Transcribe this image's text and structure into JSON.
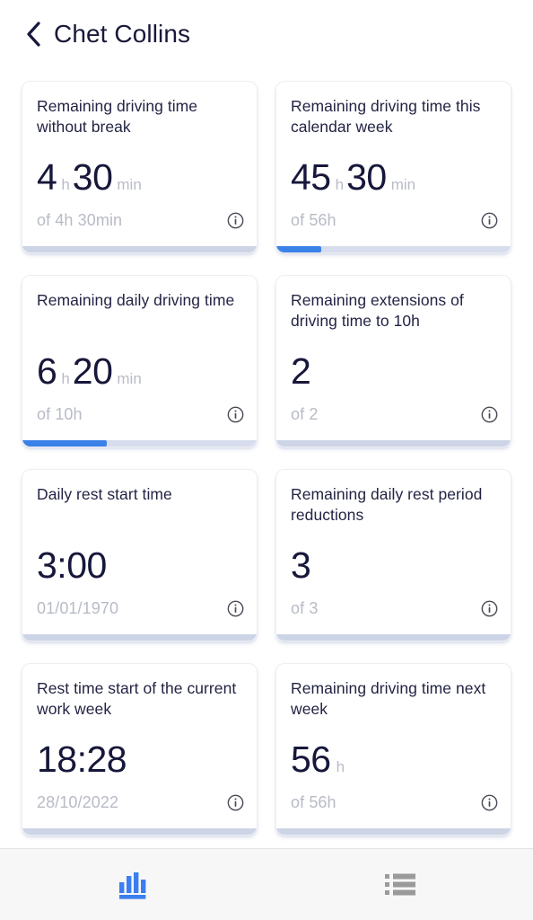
{
  "header": {
    "back_icon": "chevron-left-icon",
    "title": "Chet Collins"
  },
  "cards": [
    {
      "title": "Remaining driving time without break",
      "value": "4",
      "unit": "h",
      "value2": "30",
      "unit2": "min",
      "sub": "of 4h 30min",
      "info_icon": "info-icon",
      "progress_percent": 0
    },
    {
      "title": "Remaining driving time this calendar week",
      "value": "45",
      "unit": "h",
      "value2": "30",
      "unit2": "min",
      "sub": "of 56h",
      "info_icon": "info-icon",
      "progress_percent": 19
    },
    {
      "title": "Remaining daily driving time",
      "value": "6",
      "unit": "h",
      "value2": "20",
      "unit2": "min",
      "sub": "of 10h",
      "info_icon": "info-icon",
      "progress_percent": 36
    },
    {
      "title": "Remaining extensions of driving time to 10h",
      "value": "2",
      "unit": "",
      "value2": "",
      "unit2": "",
      "sub": "of 2",
      "info_icon": "info-icon",
      "progress_percent": 0
    },
    {
      "title": "Daily rest start time",
      "value": "3:00",
      "unit": "",
      "value2": "",
      "unit2": "",
      "sub": "01/01/1970",
      "info_icon": "info-icon",
      "progress_percent": 0
    },
    {
      "title": "Remaining daily rest period reductions",
      "value": "3",
      "unit": "",
      "value2": "",
      "unit2": "",
      "sub": "of 3",
      "info_icon": "info-icon",
      "progress_percent": 0
    },
    {
      "title": "Rest time start of the current work week",
      "value": "18:28",
      "unit": "",
      "value2": "",
      "unit2": "",
      "sub": "28/10/2022",
      "info_icon": "info-icon",
      "progress_percent": 0
    },
    {
      "title": "Remaining driving time next week",
      "value": "56",
      "unit": "h",
      "value2": "",
      "unit2": "",
      "sub": "of 56h",
      "info_icon": "info-icon",
      "progress_percent": 0
    }
  ],
  "bottom_nav": {
    "items": [
      {
        "icon": "bar-chart-icon",
        "active": true
      },
      {
        "icon": "list-icon",
        "active": false
      }
    ],
    "active_color": "#3b82e8",
    "inactive_color": "#9a9a9a"
  },
  "colors": {
    "accent_blue": "#3b82e8",
    "progress_track": "#d7dded",
    "text_dark": "#16173a",
    "text_muted": "#b8bbc6"
  }
}
